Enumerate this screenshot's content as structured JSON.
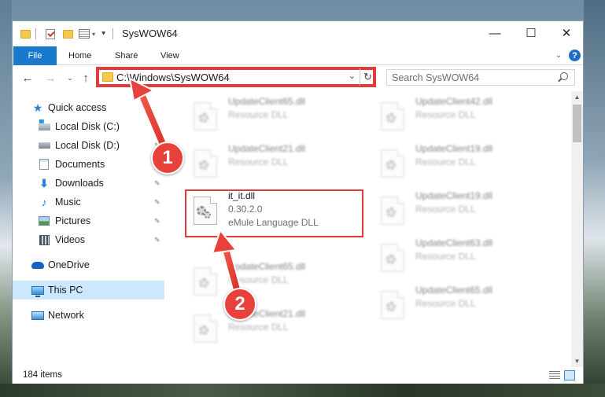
{
  "window": {
    "title": "SysWOW64",
    "controls": {
      "minimize": "—",
      "maximize": "☐",
      "close": "✕"
    }
  },
  "ribbon": {
    "tabs": [
      "File",
      "Home",
      "Share",
      "View"
    ],
    "help_label": "?"
  },
  "navigation": {
    "address": "C:\\Windows\\SysWOW64",
    "search_placeholder": "Search SysWOW64"
  },
  "sidebar": {
    "items": [
      {
        "label": "Quick access",
        "icon": "star-icon"
      },
      {
        "label": "Local Disk (C:)",
        "icon": "drive-icon",
        "pinned": true
      },
      {
        "label": "Local Disk (D:)",
        "icon": "drive-icon",
        "pinned": true
      },
      {
        "label": "Documents",
        "icon": "documents-icon",
        "pinned": true
      },
      {
        "label": "Downloads",
        "icon": "downloads-icon",
        "pinned": true
      },
      {
        "label": "Music",
        "icon": "music-icon",
        "pinned": true
      },
      {
        "label": "Pictures",
        "icon": "pictures-icon",
        "pinned": true
      },
      {
        "label": "Videos",
        "icon": "videos-icon",
        "pinned": true
      },
      {
        "label": "OneDrive",
        "icon": "onedrive-icon"
      },
      {
        "label": "This PC",
        "icon": "this-pc-icon",
        "selected": true
      },
      {
        "label": "Network",
        "icon": "network-icon"
      }
    ]
  },
  "files": {
    "col1": [
      {
        "name": "UpdateClient65.dll",
        "desc": "Resource DLL"
      },
      {
        "name": "UpdateClient21.dll",
        "desc": "Resource DLL"
      },
      {
        "name": "it_it.dll",
        "version": "0.30.2.0",
        "desc": "eMule Language DLL"
      },
      {
        "name": "UpdateClient65.dll",
        "desc": "Resource DLL"
      },
      {
        "name": "UpdateClient21.dll",
        "desc": "Resource DLL"
      }
    ],
    "col2": [
      {
        "name": "UpdateClient42.dll",
        "desc": "Resource DLL"
      },
      {
        "name": "UpdateClient19.dll",
        "desc": "Resource DLL"
      },
      {
        "name": "UpdateClient19.dll",
        "desc": "Resource DLL"
      },
      {
        "name": "UpdateClient63.dll",
        "desc": "Resource DLL"
      },
      {
        "name": "UpdateClient65.dll",
        "desc": "Resource DLL"
      }
    ]
  },
  "status": {
    "items_count": "184 items"
  },
  "annotations": {
    "step1": "1",
    "step2": "2",
    "color": "#e8403a"
  }
}
